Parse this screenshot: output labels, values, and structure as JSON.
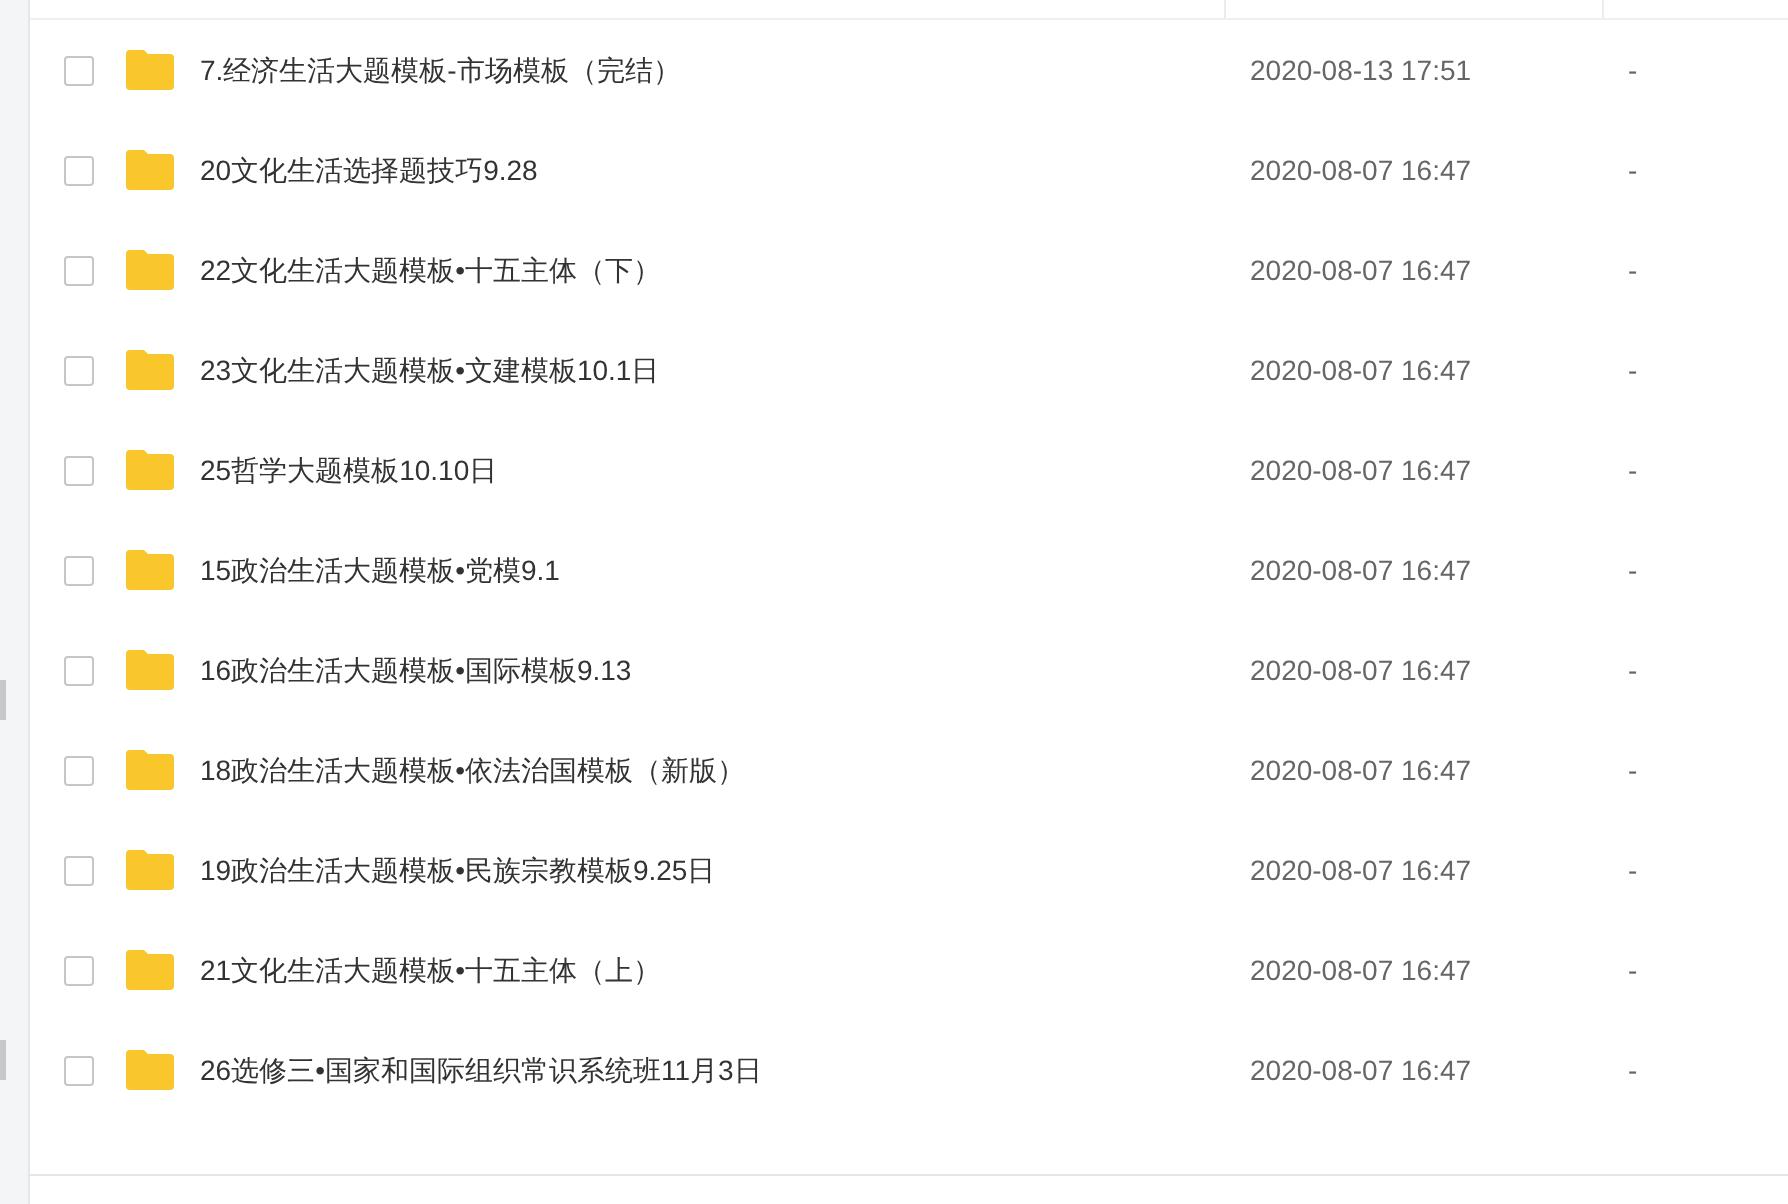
{
  "files": [
    {
      "name": "7.经济生活大题模板-市场模板（完结）",
      "modified": "2020-08-13 17:51",
      "size": "-",
      "checked": false
    },
    {
      "name": "20文化生活选择题技巧9.28",
      "modified": "2020-08-07 16:47",
      "size": "-",
      "checked": false
    },
    {
      "name": "22文化生活大题模板•十五主体（下）",
      "modified": "2020-08-07 16:47",
      "size": "-",
      "checked": false
    },
    {
      "name": "23文化生活大题模板•文建模板10.1日",
      "modified": "2020-08-07 16:47",
      "size": "-",
      "checked": false
    },
    {
      "name": "25哲学大题模板10.10日",
      "modified": "2020-08-07 16:47",
      "size": "-",
      "checked": false
    },
    {
      "name": "15政治生活大题模板•党模9.1",
      "modified": "2020-08-07 16:47",
      "size": "-",
      "checked": false
    },
    {
      "name": "16政治生活大题模板•国际模板9.13",
      "modified": "2020-08-07 16:47",
      "size": "-",
      "checked": false
    },
    {
      "name": "18政治生活大题模板•依法治国模板（新版）",
      "modified": "2020-08-07 16:47",
      "size": "-",
      "checked": false
    },
    {
      "name": "19政治生活大题模板•民族宗教模板9.25日",
      "modified": "2020-08-07 16:47",
      "size": "-",
      "checked": false
    },
    {
      "name": "21文化生活大题模板•十五主体（上）",
      "modified": "2020-08-07 16:47",
      "size": "-",
      "checked": false
    },
    {
      "name": "26选修三•国家和国际组织常识系统班11月3日",
      "modified": "2020-08-07 16:47",
      "size": "-",
      "checked": false
    }
  ]
}
